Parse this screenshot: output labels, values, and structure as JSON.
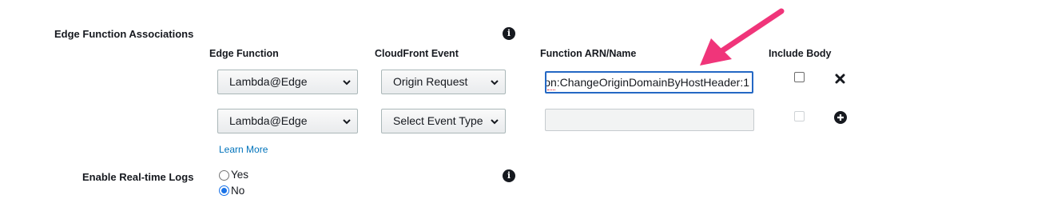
{
  "edge_function_associations": {
    "label": "Edge Function Associations",
    "info_icon": "info-icon",
    "columns": {
      "edge_function": "Edge Function",
      "cloudfront_event": "CloudFront Event",
      "function_arn": "Function ARN/Name",
      "include_body": "Include Body"
    },
    "rows": [
      {
        "edge_function": "Lambda@Edge",
        "event": "Origin Request",
        "arn_value": "on:ChangeOriginDomainByHostHeader:1",
        "arn_focused": true,
        "include_body_checked": false,
        "action_icon": "close-icon"
      },
      {
        "edge_function": "Lambda@Edge",
        "event": "Select Event Type",
        "arn_value": "",
        "arn_focused": false,
        "include_body_checked": false,
        "include_body_disabled": true,
        "action_icon": "add-circle-icon"
      }
    ],
    "learn_more": "Learn More"
  },
  "realtime_logs": {
    "label": "Enable Real-time Logs",
    "info_icon": "info-icon",
    "options": [
      {
        "label": "Yes",
        "checked": false
      },
      {
        "label": "No",
        "checked": true
      }
    ]
  },
  "annotation": {
    "arrow_color": "#f0357a",
    "arrow_icon": "arrow-annotation"
  },
  "colors": {
    "focus_border": "#2468c4",
    "link": "#0073bb",
    "radio_selected": "#1a73e8"
  }
}
